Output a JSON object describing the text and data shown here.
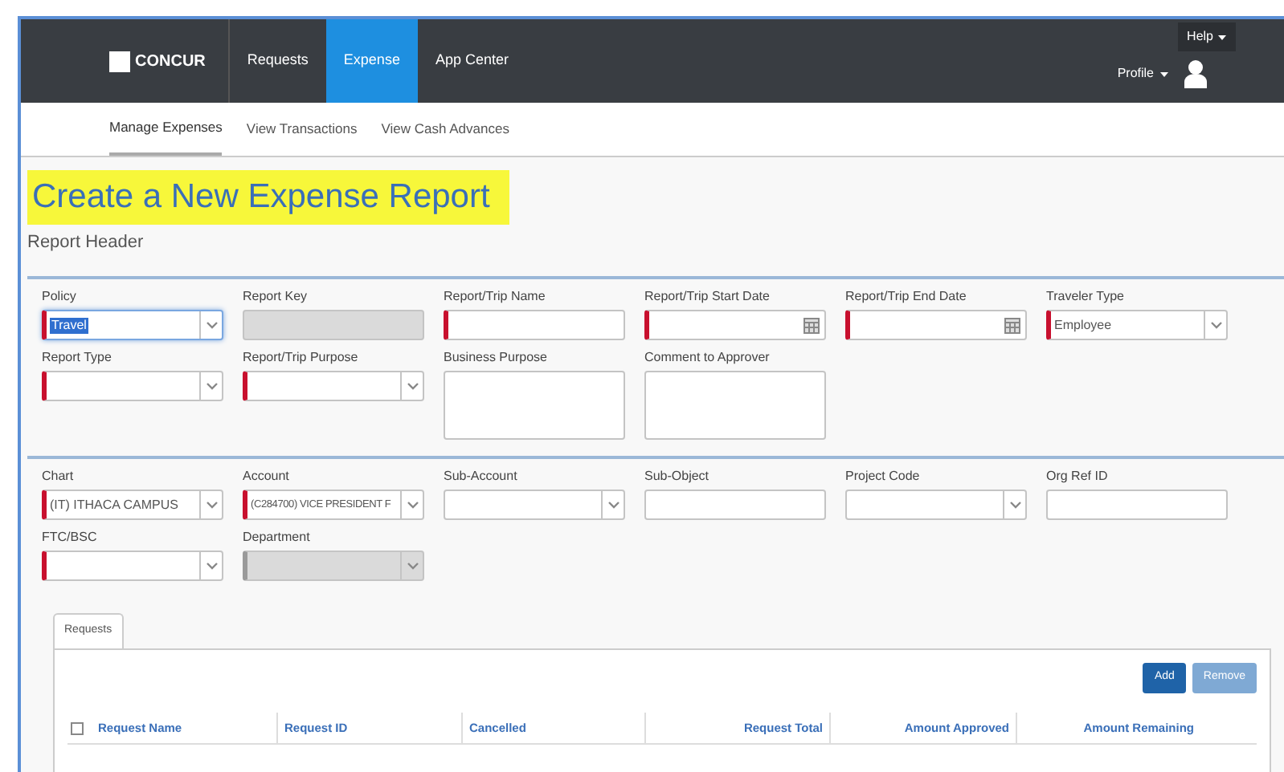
{
  "nav": {
    "logo": "CONCUR",
    "items": [
      {
        "label": "Requests",
        "selected": false
      },
      {
        "label": "Expense",
        "selected": true
      },
      {
        "label": "App Center",
        "selected": false
      }
    ],
    "help": "Help",
    "profile": "Profile"
  },
  "subnav": [
    {
      "label": "Manage Expenses",
      "selected": true
    },
    {
      "label": "View Transactions",
      "selected": false
    },
    {
      "label": "View Cash Advances",
      "selected": false
    }
  ],
  "title": "Create a New Expense Report",
  "section": "Report Header",
  "field_groups": [
    [
      {
        "label": "Policy",
        "kind": "select",
        "value": "Travel",
        "required": true,
        "disabled": false,
        "focused": true
      },
      {
        "label": "Report Key",
        "kind": "text",
        "required": false,
        "disabled": true,
        "focused": false
      },
      {
        "label": "Report/Trip Name",
        "kind": "text",
        "required": true,
        "disabled": false,
        "focused": false
      },
      {
        "label": "Report/Trip Start Date",
        "kind": "date",
        "required": true,
        "disabled": false,
        "focused": false
      },
      {
        "label": "Report/Trip End Date",
        "kind": "date",
        "required": true,
        "disabled": false,
        "focused": false
      },
      {
        "label": "Traveler Type",
        "kind": "select",
        "value": "Employee",
        "required": true,
        "disabled": false,
        "focused": false
      },
      {
        "label": "Report Type",
        "kind": "select",
        "required": true,
        "disabled": false,
        "focused": false
      },
      {
        "label": "Report/Trip Purpose",
        "kind": "select",
        "required": true,
        "disabled": false,
        "focused": false
      },
      {
        "label": "Business Purpose",
        "kind": "textarea",
        "required": false,
        "disabled": false,
        "focused": false
      },
      {
        "label": "Comment to Approver",
        "kind": "textarea",
        "required": false,
        "disabled": false,
        "focused": false
      }
    ],
    [
      {
        "label": "Chart",
        "kind": "select",
        "value": "(IT) ITHACA CAMPUS",
        "required": true,
        "disabled": false,
        "focused": false
      },
      {
        "label": "Account",
        "kind": "select",
        "value": "(C284700) VICE PRESIDENT F",
        "required": true,
        "disabled": false,
        "focused": false
      },
      {
        "label": "Sub-Account",
        "kind": "select",
        "required": false,
        "disabled": false,
        "focused": false
      },
      {
        "label": "Sub-Object",
        "kind": "text",
        "required": false,
        "disabled": false,
        "focused": false
      },
      {
        "label": "Project Code",
        "kind": "select",
        "required": false,
        "disabled": false,
        "focused": false
      },
      {
        "label": "Org Ref ID",
        "kind": "text",
        "required": false,
        "disabled": false,
        "focused": false
      },
      {
        "label": "FTC/BSC",
        "kind": "select",
        "required": true,
        "disabled": false,
        "focused": false
      },
      {
        "label": "Department",
        "kind": "select",
        "required": false,
        "disabled": true,
        "focused": false
      }
    ]
  ],
  "requests": {
    "tab": "Requests",
    "buttons": [
      {
        "label": "Add",
        "disabled": false
      },
      {
        "label": "Remove",
        "disabled": true
      }
    ],
    "select_all": {
      "checked": false
    },
    "columns": [
      "Request Name",
      "Request ID",
      "Cancelled",
      "Request Total",
      "Amount Approved",
      "Amount Remaining"
    ]
  }
}
